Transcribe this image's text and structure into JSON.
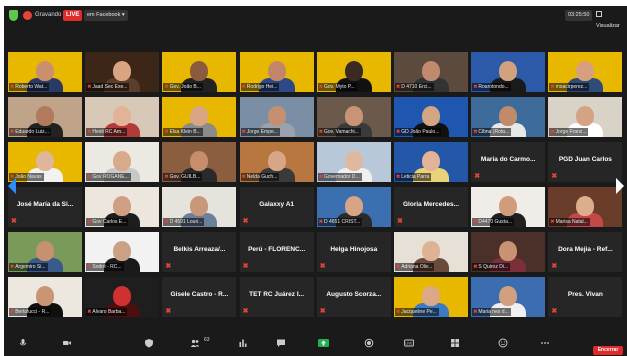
{
  "topbar": {
    "recording_label": "Gravando",
    "live_label": "LIVE",
    "live_destination": "em Facebook",
    "meeting_time": "03:25:50",
    "view_label": "Visualizar"
  },
  "participants_count": "63",
  "leave_label": "Encerrar",
  "tiles": [
    {
      "kind": "video",
      "name": "Roberto Wat...",
      "bg": "#e8b800",
      "skin": "#c98f6f",
      "shirt": "#2b3a63"
    },
    {
      "kind": "video",
      "name": "Jaad Sec Exe...",
      "bg": "#3b2618",
      "skin": "#d9a47f",
      "shirt": "#5b3d2c"
    },
    {
      "kind": "video",
      "name": "Gov. João B...",
      "bg": "#e8b800",
      "skin": "#8a5b3f",
      "shirt": "#222222"
    },
    {
      "kind": "video",
      "name": "Rodrigo Hei...",
      "bg": "#e8b800",
      "skin": "#c2866a",
      "shirt": "#2d4a86"
    },
    {
      "kind": "video",
      "name": "Gov. Myto P...",
      "bg": "#e8b800",
      "skin": "#3a2a22",
      "shirt": "#111111"
    },
    {
      "kind": "video",
      "name": "D 4710 Erci...",
      "bg": "#5d4a3e",
      "skin": "#c08a6e",
      "shirt": "#333333"
    },
    {
      "kind": "video",
      "name": "Roarotondo...",
      "bg": "#2c5aa8",
      "skin": "#d2a27f",
      "shirt": "#1a1a1a"
    },
    {
      "kind": "video",
      "name": "moacirperez...",
      "bg": "#e8b800",
      "skin": "#d7a07c",
      "shirt": "#2e4b7a"
    },
    {
      "kind": "video",
      "name": "Eduardo Luiz...",
      "bg": "#c0a48a",
      "skin": "#b07a5b",
      "shirt": "#222222"
    },
    {
      "kind": "video",
      "name": "Heidi RC Am...",
      "bg": "#d8c8b8",
      "skin": "#e2b497",
      "shirt": "#b43a3a"
    },
    {
      "kind": "video",
      "name": "Elsa Klein B...",
      "bg": "#e8b800",
      "skin": "#d8a585",
      "shirt": "#8b8b8b"
    },
    {
      "kind": "video",
      "name": "Jorge Empe...",
      "bg": "#7a8fa6",
      "skin": "#c58f70",
      "shirt": "#9aa2ad"
    },
    {
      "kind": "video",
      "name": "Gov. Vamachi...",
      "bg": "#6b5a4c",
      "skin": "#c99475",
      "shirt": "#3a3a3a"
    },
    {
      "kind": "video",
      "name": "GD João Paulo...",
      "bg": "#1e56b0",
      "skin": "#d3a583",
      "shirt": "#111111"
    },
    {
      "kind": "video",
      "name": "Cibna (Rota...",
      "bg": "#3d6b9a",
      "skin": "#bf8b6b",
      "shirt": "#e8e8e8"
    },
    {
      "kind": "video",
      "name": "Jorge Franz...",
      "bg": "#d9d2c6",
      "skin": "#d4a384",
      "shirt": "#ffffff"
    },
    {
      "kind": "video",
      "name": "João Navas",
      "bg": "#e8b800",
      "skin": "#e0b69a",
      "shirt": "#f2f2f2"
    },
    {
      "kind": "video",
      "name": "Gov ROGANE...",
      "bg": "#ece8e2",
      "skin": "#d9a98b",
      "shirt": "#c8c8c8"
    },
    {
      "kind": "video",
      "name": "Gov. GUILB...",
      "bg": "#8a5e3f",
      "skin": "#c88e6c",
      "shirt": "#2a2a2a"
    },
    {
      "kind": "video",
      "name": "Nelda Guch...",
      "bg": "#b7773e",
      "skin": "#d7a687",
      "shirt": "#3a3a3a"
    },
    {
      "kind": "video",
      "name": "Governador D...",
      "bg": "#b8c8d8",
      "skin": "#e0b8a0",
      "shirt": "#f0f0f0"
    },
    {
      "kind": "video",
      "name": "Leticia Parra",
      "bg": "#2557a8",
      "skin": "#e2b394",
      "shirt": "#e9d27a"
    },
    {
      "kind": "name",
      "name": "Maria do Carmo..."
    },
    {
      "kind": "name",
      "name": "PGD Juan Carlos"
    },
    {
      "kind": "name",
      "name": "José María da Si..."
    },
    {
      "kind": "video",
      "name": "Gov Carlos E...",
      "bg": "#ece6dc",
      "skin": "#d09e82",
      "shirt": "#1d1d1d"
    },
    {
      "kind": "video",
      "name": "D 4591 Louri...",
      "bg": "#e6e3dc",
      "skin": "#c9977a",
      "shirt": "#6a7f9a"
    },
    {
      "kind": "name",
      "name": "Galaxxy A1"
    },
    {
      "kind": "video",
      "name": "D 4651 CRIST...",
      "bg": "#3c6fb0",
      "skin": "#d7a585",
      "shirt": "#2a2a2a"
    },
    {
      "kind": "name",
      "name": "Gloria Mercedes..."
    },
    {
      "kind": "video",
      "name": "D4470 Gusta...",
      "bg": "#f0ede8",
      "skin": "#d19c7c",
      "shirt": "#1f1f1f"
    },
    {
      "kind": "video",
      "name": "Marisa Natal...",
      "bg": "#6a3c2a",
      "skin": "#dcae8c",
      "shirt": "#c54747"
    },
    {
      "kind": "video",
      "name": "Argemiro Si...",
      "bg": "#7a9a5a",
      "skin": "#c7906f",
      "shirt": "#3b5a8c"
    },
    {
      "kind": "video",
      "name": "Sodré - RC...",
      "bg": "#f2f2f2",
      "skin": "#caa184",
      "shirt": "#1a1a1a"
    },
    {
      "kind": "name",
      "name": "Belkis Arreaza/..."
    },
    {
      "kind": "name",
      "name": "Perú - FLORENC..."
    },
    {
      "kind": "name",
      "name": "Helga Hinojosa"
    },
    {
      "kind": "video",
      "name": "Adriana Oliv...",
      "bg": "#e6e0d6",
      "skin": "#ddb394",
      "shirt": "#6a4a3a"
    },
    {
      "kind": "video",
      "name": "S Quiroz Di...",
      "bg": "#4a3028",
      "skin": "#c89372",
      "shirt": "#7a2f3a"
    },
    {
      "kind": "name",
      "name": "Dora Mejia - Ref..."
    },
    {
      "kind": "video",
      "name": "Bertolucci - R...",
      "bg": "#ece8e0",
      "skin": "#c99574",
      "shirt": "#101010"
    },
    {
      "kind": "video",
      "name": "Alvaro Barba...",
      "bg": "#1e1e1e",
      "skin": "#d03030",
      "shirt": "#4a1010"
    },
    {
      "kind": "name",
      "name": "Gisele Castro - R..."
    },
    {
      "kind": "name",
      "name": "TET RC Juárez I..."
    },
    {
      "kind": "name",
      "name": "Augusto Scorza..."
    },
    {
      "kind": "video",
      "name": "Jacqueline Pe...",
      "bg": "#e8b800",
      "skin": "#dba98a",
      "shirt": "#3d7ac4"
    },
    {
      "kind": "video",
      "name": "Maria nes d...",
      "bg": "#3c6db0",
      "skin": "#d2a07f",
      "shirt": "#f0f0f0"
    },
    {
      "kind": "name",
      "name": "Pres. Vivan"
    }
  ]
}
